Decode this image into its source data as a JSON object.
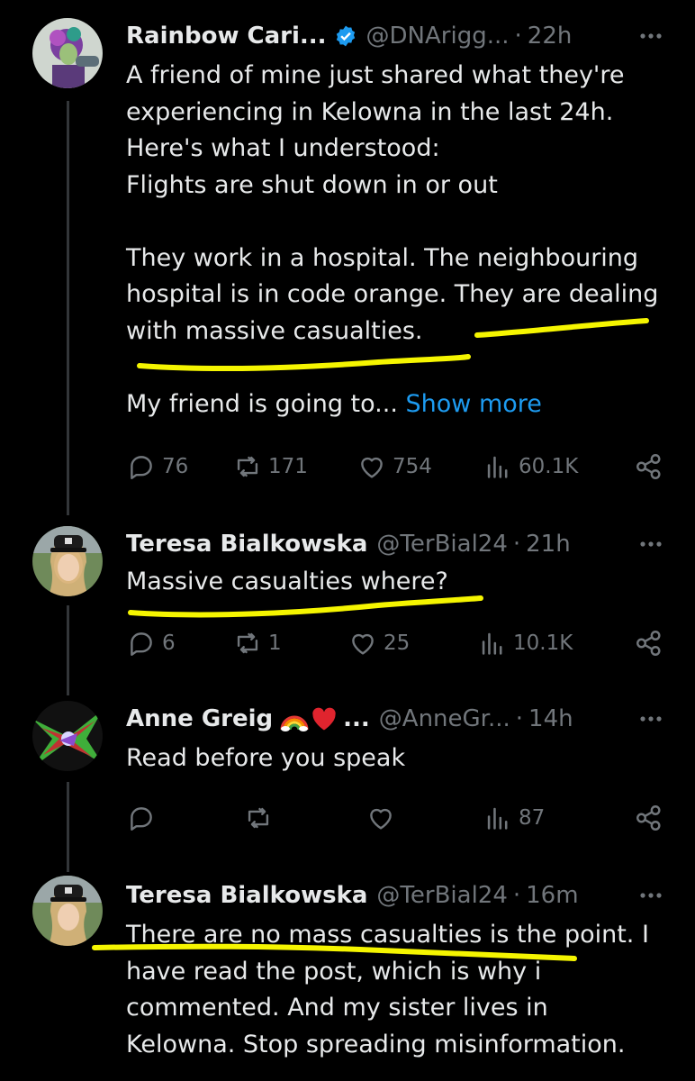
{
  "tweets": [
    {
      "name": "Rainbow Cari...",
      "verified": true,
      "handle": "@DNArigg...",
      "time": "22h",
      "lines": [
        "A friend of mine just shared what they're",
        "experiencing in Kelowna in the last 24h.",
        "Here's what I understood:",
        "Flights are shut down in or out",
        "",
        "They work in a hospital. The neighbouring",
        "hospital is in code orange. They are dealing",
        "with massive casualties.",
        "",
        "My friend is going to..."
      ],
      "show_more": "Show more",
      "replies": "76",
      "retweets": "171",
      "likes": "754",
      "views": "60.1K"
    },
    {
      "name": "Teresa Bialkowska",
      "handle": "@TerBial24",
      "time": "21h",
      "lines": [
        "Massive casualties where?"
      ],
      "replies": "6",
      "retweets": "1",
      "likes": "25",
      "views": "10.1K"
    },
    {
      "name": "Anne Greig",
      "name_suffix": "...",
      "name_emojis": [
        "rainbow-emoji",
        "red-heart-emoji"
      ],
      "handle": "@AnneGr...",
      "time": "14h",
      "lines": [
        "Read before you speak"
      ],
      "views": "87"
    },
    {
      "name": "Teresa Bialkowska",
      "handle": "@TerBial24",
      "time": "16m",
      "lines": [
        "There are no mass casualties is the point. I",
        "have read the post, which is why i",
        "commented.  And my sister lives in",
        "Kelowna. Stop spreading misinformation."
      ]
    }
  ],
  "colors": {
    "background": "#000000",
    "text": "#e7e9ea",
    "secondary": "#71767b",
    "link": "#1d9bf0",
    "verified": "#1d9bf0",
    "highlight": "#f5f500",
    "thread_line": "#333639"
  },
  "icons": [
    "reply-icon",
    "retweet-icon",
    "like-icon",
    "views-icon",
    "share-icon",
    "more-icon",
    "verified-badge-icon"
  ]
}
